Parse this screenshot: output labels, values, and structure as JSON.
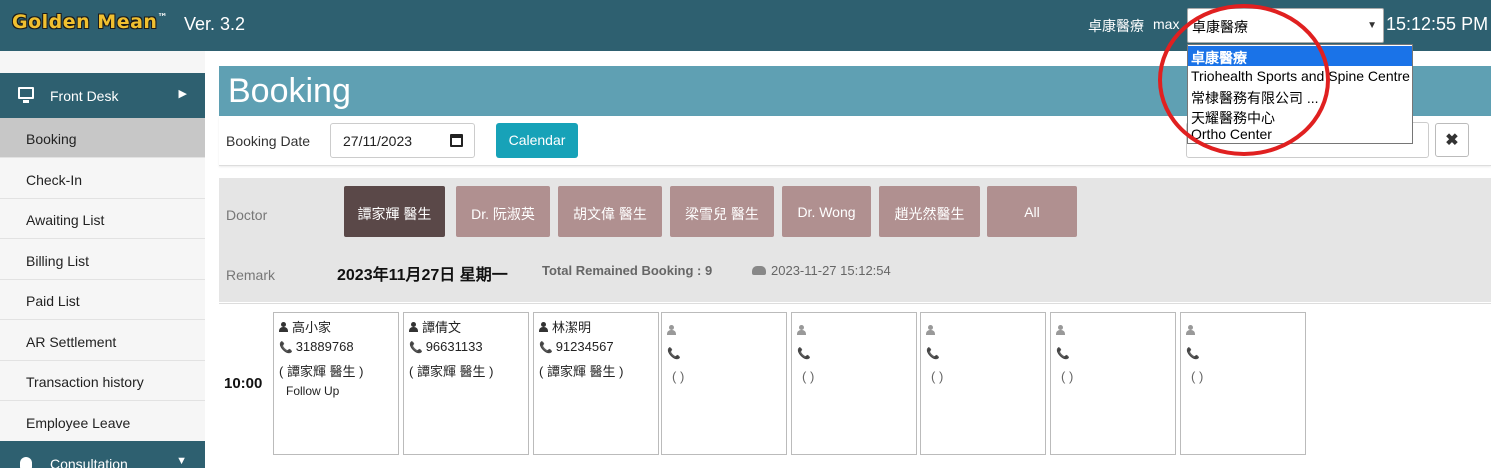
{
  "header": {
    "logo_text": "Golden Mean",
    "logo_tm": "™",
    "version": "Ver. 3.2",
    "clinic_name": "卓康醫療",
    "user": "max",
    "clinic_select_value": "卓康醫療",
    "clock": "15:12:55 PM",
    "brand_color": "#2e6070"
  },
  "dropdown": {
    "options": [
      "卓康醫療",
      "Triohealth Sports and Spine Centre",
      "常棣醫務有限公司 ...",
      "天耀醫務中心",
      "Ortho Center"
    ],
    "selected_index": 0
  },
  "sidebar": {
    "section_label": "Front Desk",
    "items": [
      {
        "label": "Booking",
        "active": true
      },
      {
        "label": "Check-In"
      },
      {
        "label": "Awaiting List"
      },
      {
        "label": "Billing List"
      },
      {
        "label": "Paid List"
      },
      {
        "label": "AR Settlement"
      },
      {
        "label": "Transaction history"
      },
      {
        "label": "Employee Leave"
      }
    ],
    "next_section_label": "Consultation"
  },
  "page": {
    "title": "Booking"
  },
  "filter": {
    "date_label": "Booking Date",
    "date_value": "27/11/2023",
    "calendar_button": "Calendar",
    "clear_button": "✖"
  },
  "doctor_panel": {
    "doctor_label": "Doctor",
    "remark_label": "Remark",
    "doctors": [
      {
        "label": "譚家輝 醫生",
        "active": true
      },
      {
        "label": "Dr. 阮淑英"
      },
      {
        "label": "胡文偉 醫生"
      },
      {
        "label": "梁雪兒 醫生"
      },
      {
        "label": "Dr. Wong"
      },
      {
        "label": "趙光然醫生"
      },
      {
        "label": "All"
      }
    ],
    "date_heading": "2023年11月27日 星期一",
    "remained_text": "Total Remained Booking : 9",
    "timestamp": "2023-11-27 15:12:54"
  },
  "schedule": {
    "time": "10:00",
    "slots": [
      {
        "name": "高小家",
        "phone": "31889768",
        "doctor": "( 譚家輝 醫生 )",
        "note": "Follow Up"
      },
      {
        "name": "譚倩文",
        "phone": "96631133",
        "doctor": "( 譚家輝 醫生 )",
        "note": ""
      },
      {
        "name": "林潔明",
        "phone": "91234567",
        "doctor": "( 譚家輝 醫生 )",
        "note": ""
      },
      {
        "name": "",
        "phone": "",
        "doctor": "( )",
        "note": ""
      },
      {
        "name": "",
        "phone": "",
        "doctor": "( )",
        "note": ""
      },
      {
        "name": "",
        "phone": "",
        "doctor": "( )",
        "note": ""
      },
      {
        "name": "",
        "phone": "",
        "doctor": "( )",
        "note": ""
      },
      {
        "name": "",
        "phone": "",
        "doctor": "( )",
        "note": ""
      }
    ]
  }
}
